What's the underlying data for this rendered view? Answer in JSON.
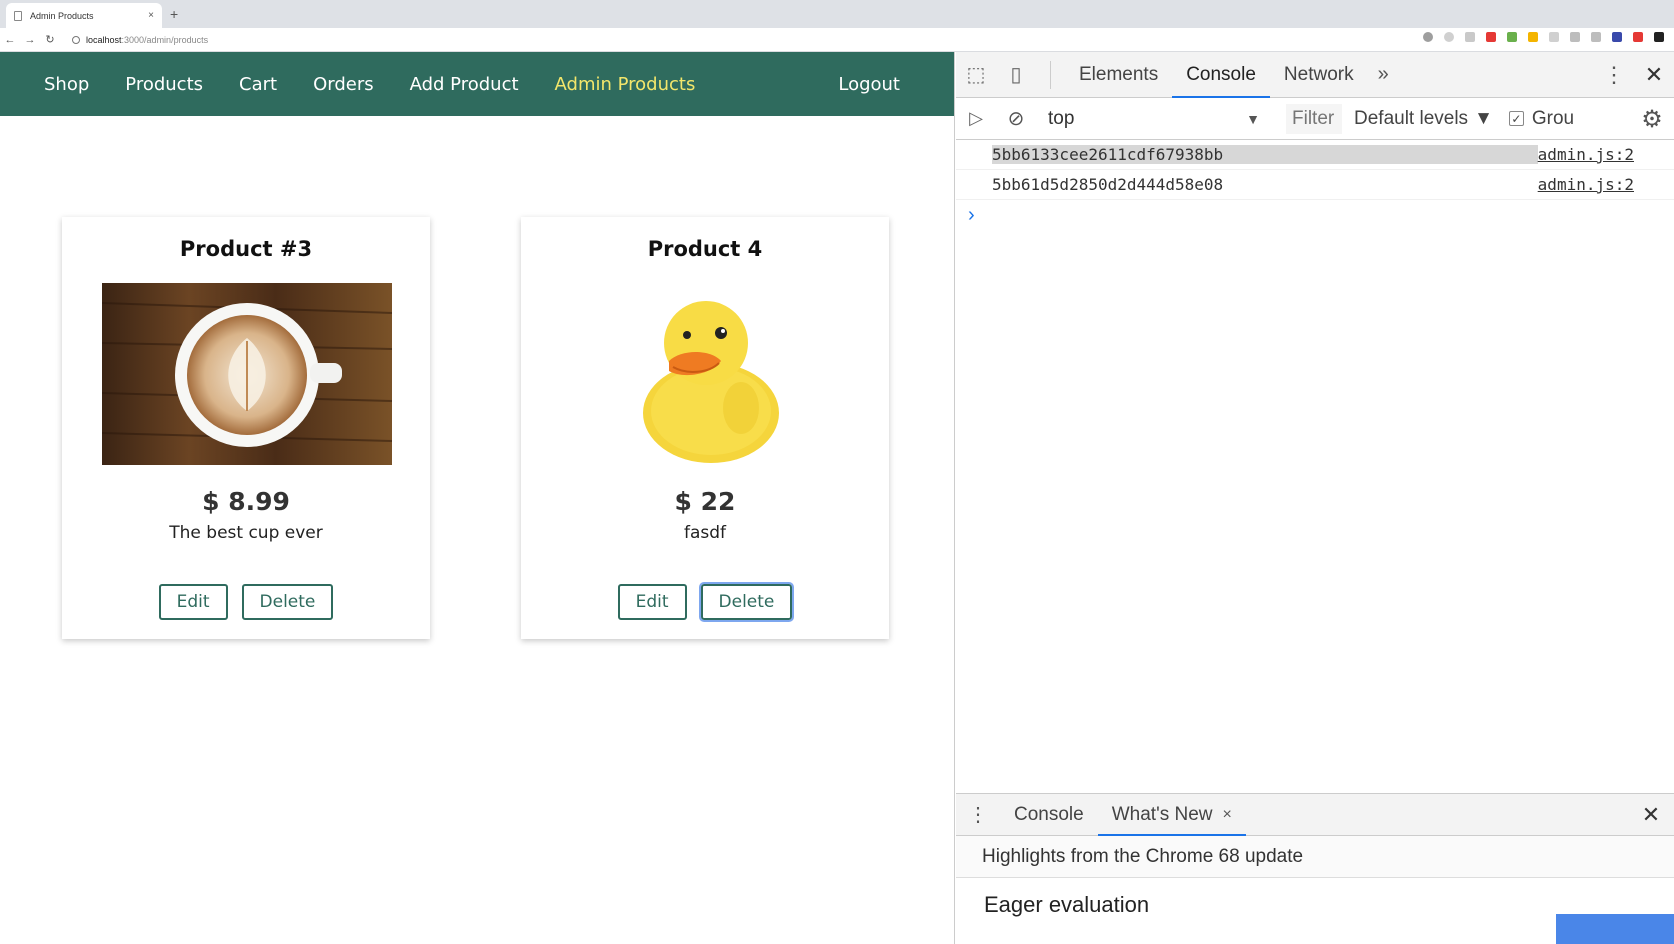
{
  "browser": {
    "tab_title": "Admin Products",
    "tab_close": "×",
    "new_tab": "+",
    "url_host": "localhost",
    "url_path": ":3000/admin/products",
    "nav_back": "←",
    "nav_forward": "→",
    "nav_reload": "↻",
    "extension_colors": [
      "#9e9e9e",
      "#d0d0d0",
      "#c9c9c9",
      "#e53935",
      "#6ab04c",
      "#f4b400",
      "#d0d0d0",
      "#bdbdbd",
      "#bdbdbd",
      "#3949ab",
      "#e53935",
      "#222222"
    ]
  },
  "shop": {
    "nav": {
      "items": [
        "Shop",
        "Products",
        "Cart",
        "Orders",
        "Add Product",
        "Admin Products"
      ],
      "active_index": 5,
      "logout": "Logout"
    },
    "products": [
      {
        "title": "Product #3",
        "price": "$ 8.99",
        "description": "The best cup ever",
        "image": "coffee-cup-image",
        "edit_label": "Edit",
        "delete_label": "Delete"
      },
      {
        "title": "Product 4",
        "price": "$ 22",
        "description": "fasdf",
        "image": "rubber-duck-image",
        "edit_label": "Edit",
        "delete_label": "Delete"
      }
    ],
    "colors": {
      "header": "#2f6b5e",
      "active_nav": "#f3e66b",
      "button": "#2f6b5e"
    }
  },
  "devtools": {
    "tabs": [
      "Elements",
      "Console",
      "Network"
    ],
    "active_tab": "Console",
    "more_tabs": "»",
    "context": "top",
    "filter_placeholder": "Filter",
    "levels": "Default levels",
    "group_label": "Grou",
    "console_lines": [
      {
        "message": "5bb6133cee2611cdf67938bb",
        "source": "admin.js:2",
        "selected": true
      },
      {
        "message": "5bb61d5d2850d2d444d58e08",
        "source": "admin.js:2",
        "selected": false
      }
    ],
    "prompt": "›",
    "drawer": {
      "tabs": [
        "Console",
        "What's New"
      ],
      "active_tab": "What's New",
      "tab_close": "×",
      "subheading": "Highlights from the Chrome 68 update",
      "body_title": "Eager evaluation"
    },
    "accent": "#1a73e8"
  }
}
